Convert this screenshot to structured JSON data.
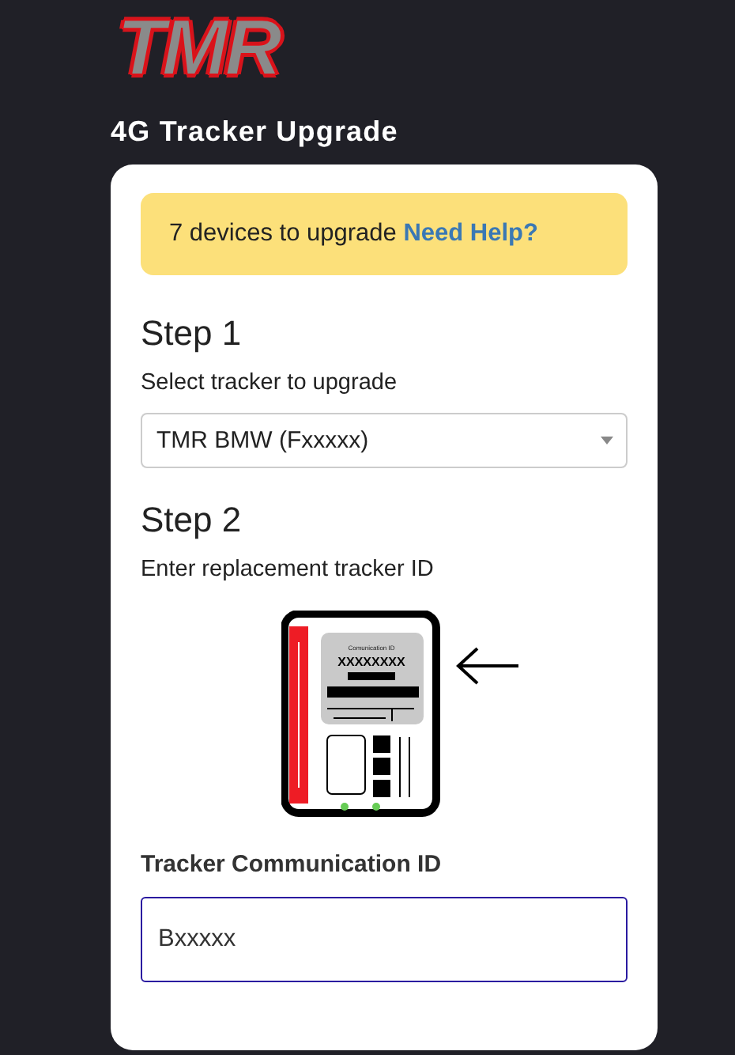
{
  "logo": "TMR",
  "title": "4G Tracker Upgrade",
  "banner": {
    "text": "7 devices to upgrade",
    "link": "Need Help?"
  },
  "steps": [
    {
      "heading": "Step 1",
      "label": "Select tracker to upgrade"
    },
    {
      "heading": "Step 2",
      "label": "Enter replacement tracker ID"
    }
  ],
  "select": {
    "value": "TMR BMW (Fxxxxx)"
  },
  "device": {
    "caption": "Comunication ID",
    "id": "XXXXXXXX"
  },
  "field": {
    "label": "Tracker Communication ID",
    "value": "Bxxxxx",
    "focused": true
  }
}
